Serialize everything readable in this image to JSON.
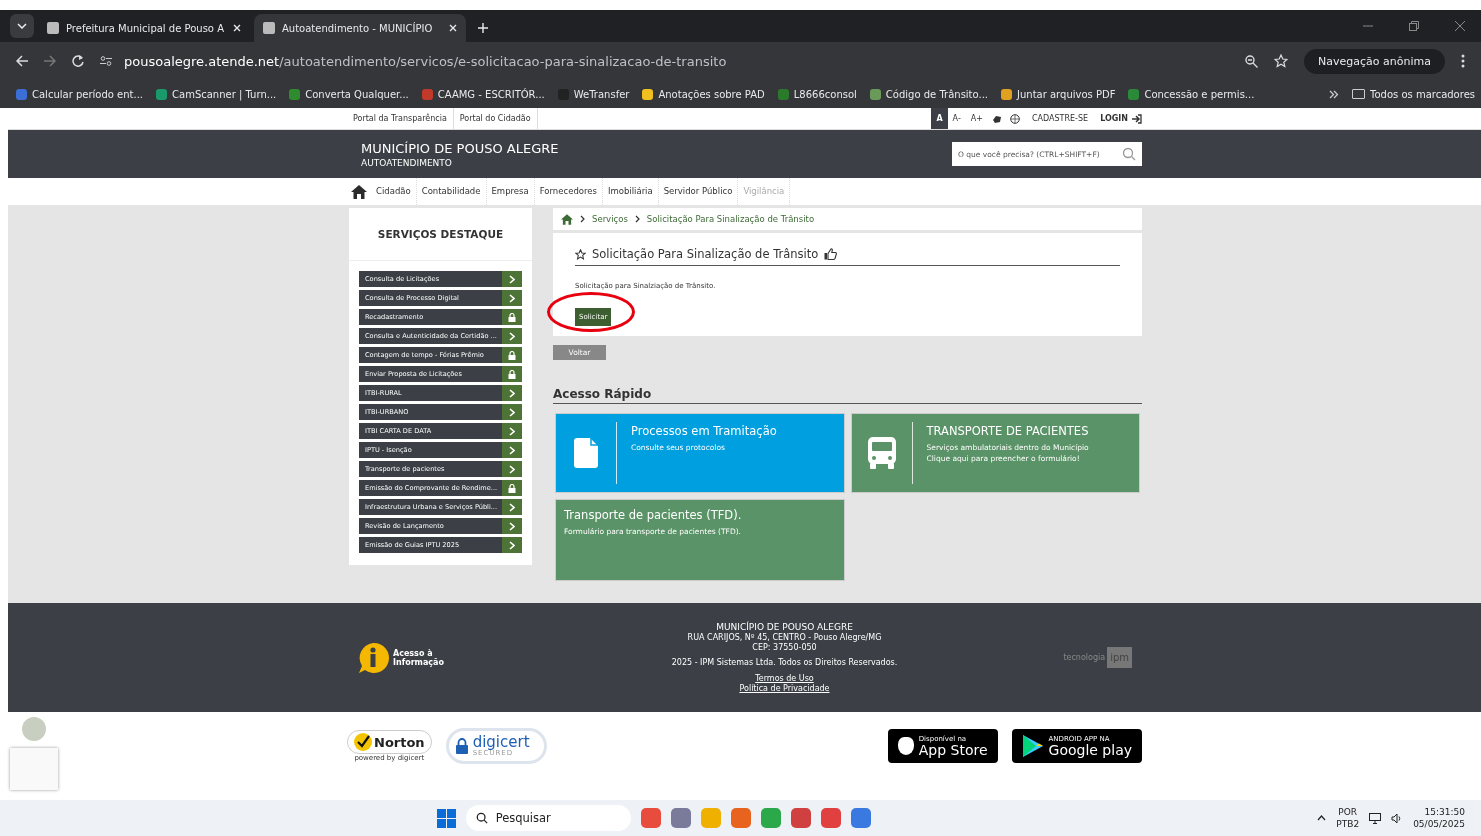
{
  "browser": {
    "tabs": [
      {
        "title": "Prefeitura Municipal de Pouso A",
        "selected": false
      },
      {
        "title": "Autoatendimento - MUNICÍPIO",
        "selected": true
      }
    ],
    "url_host": "pousoalegre.atende.net",
    "url_path": "/autoatendimento/servicos/e-solicitacao-para-sinalizacao-de-transito",
    "incognito": "Navegação anônima",
    "bookmarks": [
      "Calcular período ent...",
      "CamScanner | Turn...",
      "Converta Qualquer...",
      "CAAMG - ESCRITÓR...",
      "WeTransfer",
      "Anotações sobre PAD",
      "L8666consol",
      "Código de Trânsito...",
      "Juntar arquivos PDF",
      "Concessão e permis..."
    ],
    "all_bookmarks": "Todos os marcadores"
  },
  "topbar": {
    "links": [
      "Portal da Transparência",
      "Portal do Cidadão"
    ],
    "font_buttons": [
      "A",
      "A-",
      "A+"
    ],
    "register": "CADASTRE-SE",
    "login": "LOGIN"
  },
  "header": {
    "title": "MUNICÍPIO DE POUSO ALEGRE",
    "subtitle": "AUTOATENDIMENTO",
    "search_placeholder": "O que você precisa? (CTRL+SHIFT+F)"
  },
  "nav": [
    {
      "label": "Cidadão",
      "disabled": false
    },
    {
      "label": "Contabilidade",
      "disabled": false
    },
    {
      "label": "Empresa",
      "disabled": false
    },
    {
      "label": "Fornecedores",
      "disabled": false
    },
    {
      "label": "Imobiliária",
      "disabled": false
    },
    {
      "label": "Servidor Público",
      "disabled": false
    },
    {
      "label": "Vigilância",
      "disabled": true
    }
  ],
  "sidebar": {
    "title": "SERVIÇOS DESTAQUE",
    "items": [
      {
        "label": "Consulta de Licitações",
        "kind": "arrow"
      },
      {
        "label": "Consulta de Processo Digital",
        "kind": "arrow"
      },
      {
        "label": "Recadastramento",
        "kind": "lock"
      },
      {
        "label": "Consulta e Autenticidade da Certidão ...",
        "kind": "arrow"
      },
      {
        "label": "Contagem de tempo - Férias Prêmio",
        "kind": "lock"
      },
      {
        "label": "Enviar Proposta de Licitações",
        "kind": "lock"
      },
      {
        "label": "ITBI-RURAL",
        "kind": "arrow"
      },
      {
        "label": "ITBI-URBANO",
        "kind": "arrow"
      },
      {
        "label": "ITBI CARTA DE DATA",
        "kind": "arrow"
      },
      {
        "label": "IPTU - Isenção",
        "kind": "arrow"
      },
      {
        "label": "Transporte de pacientes",
        "kind": "arrow"
      },
      {
        "label": "Emissão do Comprovante de Rendime...",
        "kind": "lock"
      },
      {
        "label": "Infraestrutura Urbana e Serviços Públi...",
        "kind": "arrow"
      },
      {
        "label": "Revisão de Lançamento",
        "kind": "arrow"
      },
      {
        "label": "Emissão de Guias IPTU 2025",
        "kind": "arrow"
      }
    ]
  },
  "breadcrumb": [
    "Serviços",
    "Solicitação Para Sinalização de Trânsito"
  ],
  "service": {
    "title": "Solicitação Para Sinalização de Trânsito",
    "description": "Solicitação para Sinalziação de Trânsito.",
    "request_button": "Solicitar",
    "back_button": "Voltar"
  },
  "quick_access": {
    "title": "Acesso Rápido",
    "cards": [
      {
        "title": "Processos em Tramitação",
        "lines": [
          "Consulte seus protocolos"
        ],
        "kind": "document",
        "color": "#00a0e0"
      },
      {
        "title": "TRANSPORTE DE PACIENTES",
        "lines": [
          "Serviços ambulatoriais dentro do Município",
          "Clique aqui para preencher o formulário!"
        ],
        "kind": "bus",
        "color": "#5a9367"
      },
      {
        "title": "Transporte de pacientes (TFD).",
        "lines": [
          "Formulário para transporte de pacientes (TFD)."
        ],
        "kind": "plain",
        "color": "#5a9367"
      }
    ]
  },
  "footer": {
    "info": "Acesso à Informação",
    "name": "MUNICÍPIO DE POUSO ALEGRE",
    "address": "RUA CARIJOS, Nº 45, CENTRO - Pouso Alegre/MG",
    "cep": "CEP: 37550-050",
    "copyright": "2025 - IPM Sistemas Ltda. Todos os Direitos Reservados.",
    "links": [
      "Termos de Uso",
      "Política de Privacidade"
    ],
    "tech": "tecnologia",
    "tech_logo": "ipm"
  },
  "seals": {
    "norton": "Norton",
    "norton_sub": "powered by digicert",
    "digicert": "digicert",
    "digicert_sub": "SECURED",
    "appstore_top": "Disponível na",
    "appstore": "App Store",
    "play_top": "ANDROID APP NA",
    "play": "Google play"
  },
  "taskbar": {
    "search": "Pesquisar",
    "lang": "POR",
    "layout": "PTB2",
    "time": "15:31:50",
    "date": "05/05/2025"
  }
}
